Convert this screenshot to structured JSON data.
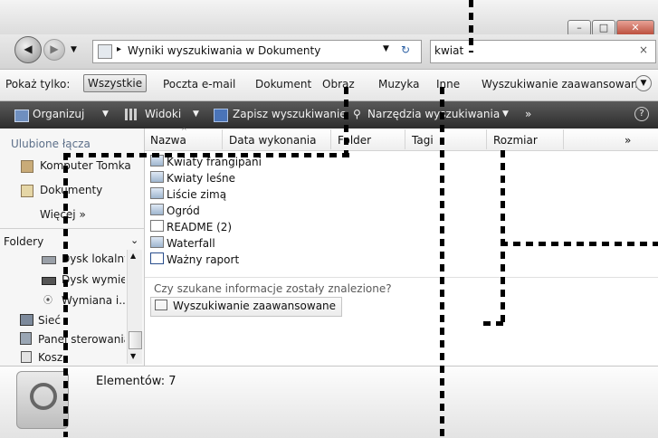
{
  "window": {
    "buttons": {
      "minimize": "–",
      "maximize": "□",
      "close": "✕"
    }
  },
  "nav": {
    "back_icon": "arrow-left-icon",
    "forward_icon": "arrow-right-icon",
    "path_sep": "▸",
    "location": "Wyniki wyszukiwania w Dokumenty"
  },
  "search": {
    "value": "kwiat",
    "clear": "×"
  },
  "filter": {
    "label": "Pokaż tylko:",
    "items": [
      "Wszystkie",
      "Poczta e-mail",
      "Dokument",
      "Obraz",
      "Muzyka",
      "Inne"
    ],
    "advanced": "Wyszukiwanie zaawansowane"
  },
  "toolbar": {
    "organize": "Organizuj",
    "views": "Widoki",
    "save_search": "Zapisz wyszukiwanie",
    "search_tools": "Narzędzia wyszukiwania",
    "more": "»",
    "help": "?"
  },
  "navpane": {
    "favorites_heading": "Ulubione łącza",
    "favorites": [
      "Komputer Tomka",
      "Dokumenty"
    ],
    "more": "Więcej  »",
    "folders_heading": "Foldery",
    "folders": [
      "Dysk lokalny",
      "Dysk wymienny",
      "Wymiana i...",
      "Sieć",
      "Panel sterowania",
      "Kosz"
    ]
  },
  "columns": [
    "Nazwa",
    "Data wykonania",
    "Folder",
    "Tagi",
    "Rozmiar",
    "»"
  ],
  "files": [
    {
      "name": "Kwiaty frangipani",
      "icon": "image"
    },
    {
      "name": "Kwiaty leśne",
      "icon": "image"
    },
    {
      "name": "Liście zimą",
      "icon": "image"
    },
    {
      "name": "Ogród",
      "icon": "image"
    },
    {
      "name": "README (2)",
      "icon": "text"
    },
    {
      "name": "Waterfall",
      "icon": "image"
    },
    {
      "name": "Ważny raport",
      "icon": "word"
    }
  ],
  "search_prompt": {
    "question": "Czy szukane informacje zostały znalezione?",
    "button": "Wyszukiwanie zaawansowane"
  },
  "status": {
    "items": "Elementów: 7"
  }
}
